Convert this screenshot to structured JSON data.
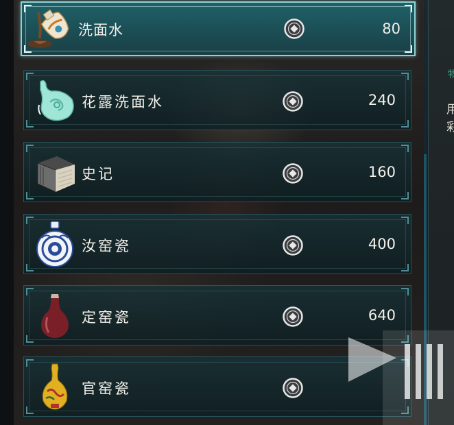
{
  "shop": {
    "items": [
      {
        "name": "洗面水",
        "price": "80",
        "icon": "bottle-pouring-icon",
        "selected": true
      },
      {
        "name": "花露洗面水",
        "price": "240",
        "icon": "jade-vase-icon",
        "selected": false
      },
      {
        "name": "史记",
        "price": "160",
        "icon": "book-icon",
        "selected": false
      },
      {
        "name": "汝窑瓷",
        "price": "400",
        "icon": "blue-white-flask-icon",
        "selected": false
      },
      {
        "name": "定窑瓷",
        "price": "640",
        "icon": "red-vase-icon",
        "selected": false
      },
      {
        "name": "官窑瓷",
        "price": "",
        "icon": "yellow-vase-icon",
        "selected": false
      }
    ],
    "currency_icon": "copper-coin-icon"
  },
  "detail_panel": {
    "label": "物",
    "description_lines": [
      "用",
      "彩"
    ]
  },
  "colors": {
    "accent": "#8fd3d6",
    "panel": "#1c4e55",
    "text": "#f2f0ea",
    "label_green": "#3f9a7c"
  }
}
